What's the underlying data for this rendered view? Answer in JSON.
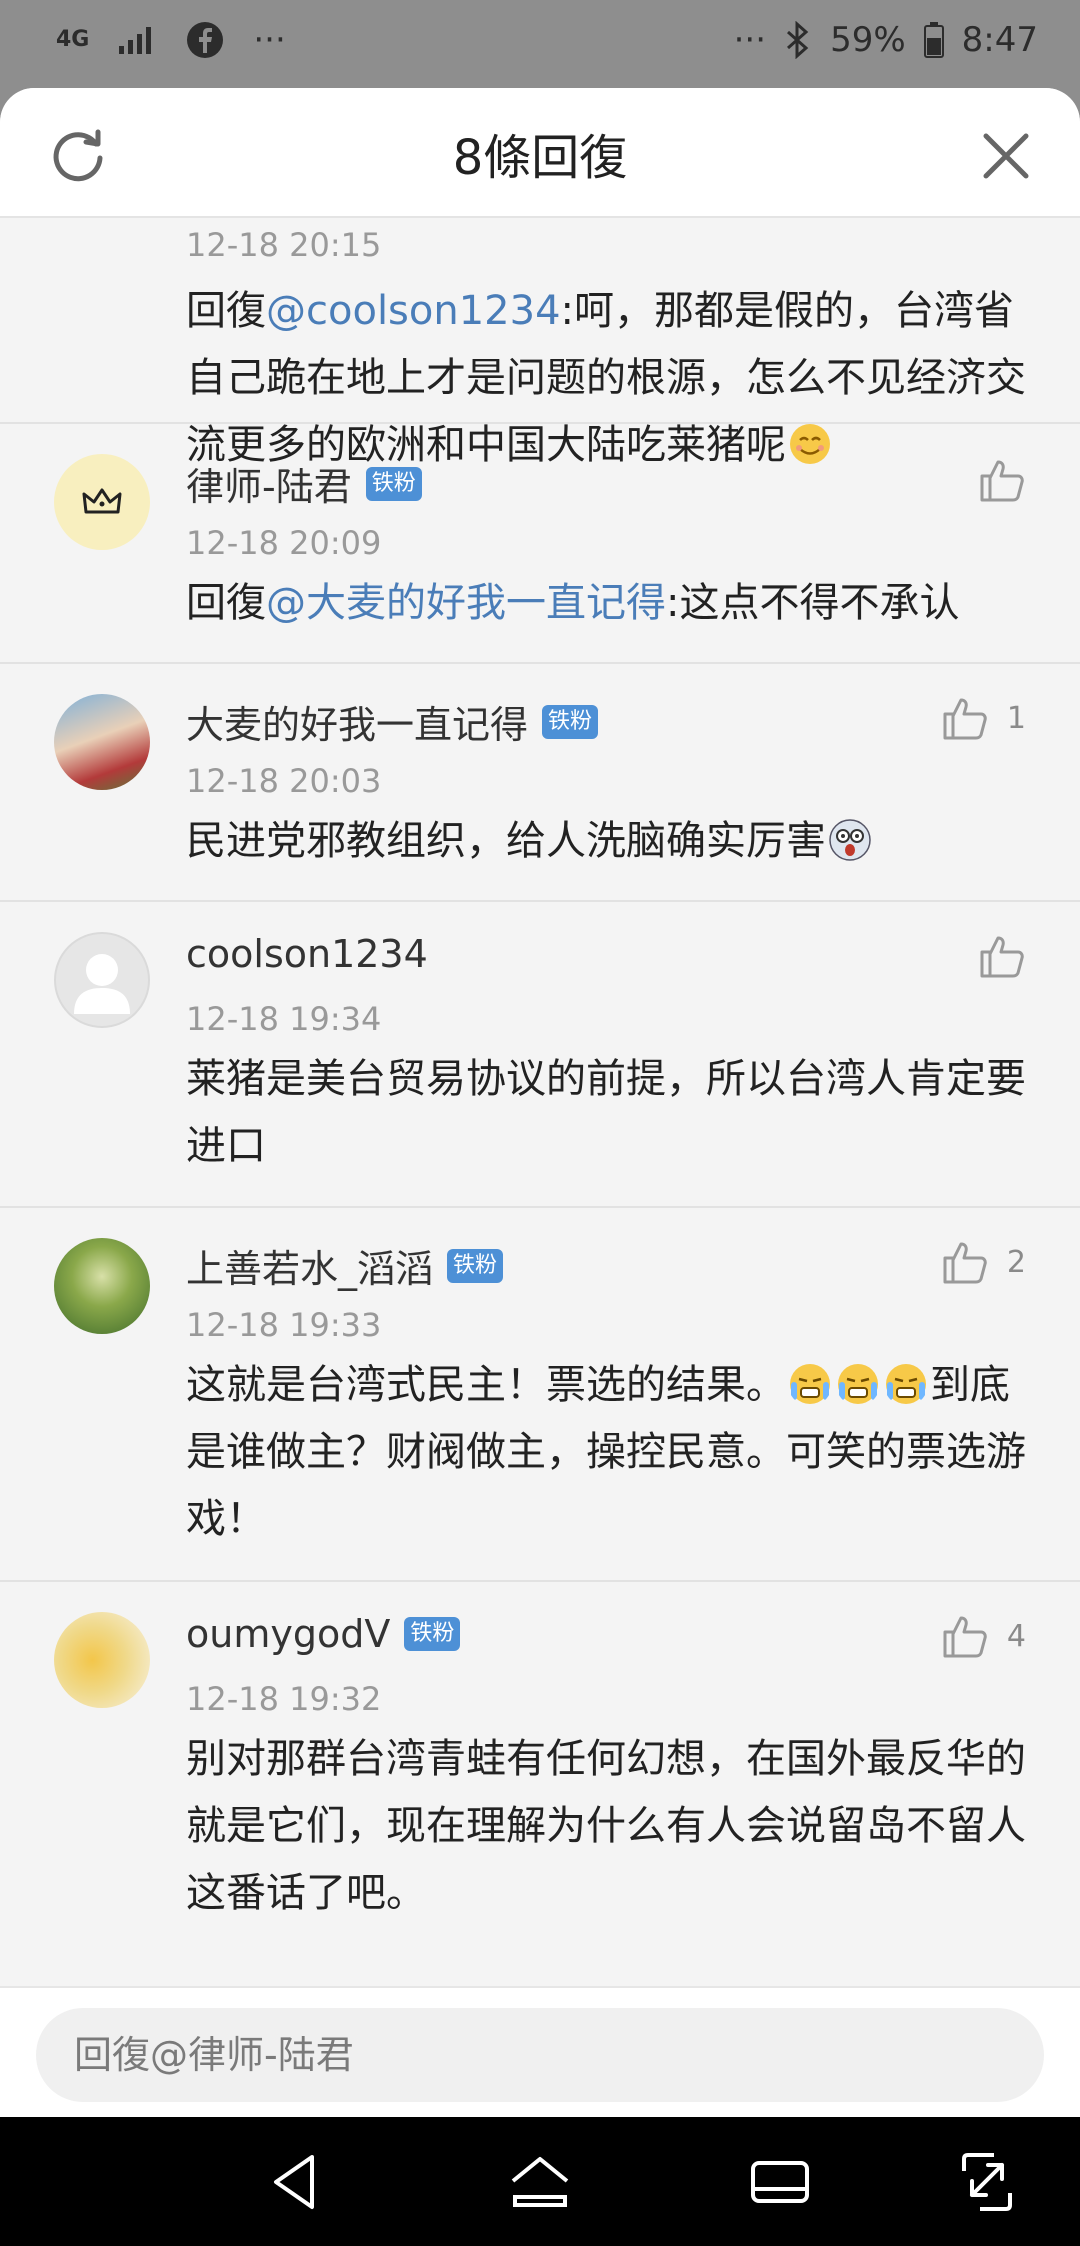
{
  "status_bar": {
    "network": "4G",
    "battery": "59%",
    "time": "8:47",
    "icons": [
      "signal-icon",
      "facebook-icon",
      "more-icon",
      "bluetooth-icon",
      "battery-icon"
    ]
  },
  "header": {
    "title": "8條回復",
    "icons": [
      "refresh-icon",
      "close-icon"
    ]
  },
  "comments": [
    {
      "time": "12-18 20:15",
      "reply_prefix": "回復",
      "mention": "@coolson1234",
      "text": ":呵，那都是假的，台湾省自己跪在地上才是问题的根源，怎么不见经济交流更多的欧洲和中国大陆吃莱猪呢",
      "emoji": "smile-emoji"
    },
    {
      "name": "律师-陆君",
      "badge": "铁粉",
      "time": "12-18 20:09",
      "reply_prefix": "回復",
      "mention": "@大麦的好我一直记得",
      "text": ":这点不得不承认",
      "likes": ""
    },
    {
      "name": "大麦的好我一直记得",
      "badge": "铁粉",
      "time": "12-18 20:03",
      "text": "民进党邪教组织，给人洗脑确实厉害",
      "likes": "1",
      "emoji": "dizzy-emoji"
    },
    {
      "name": "coolson1234",
      "time": "12-18 19:34",
      "text": "莱猪是美台贸易协议的前提，所以台湾人肯定要进口",
      "likes": ""
    },
    {
      "name": "上善若水_滔滔",
      "badge": "铁粉",
      "time": "12-18 19:33",
      "text_before": "这就是台湾式民主！票选的结果。",
      "text_after": "到底是谁做主？财阀做主，操控民意。可笑的票选游戏！",
      "likes": "2",
      "emoji": "crying-emoji"
    },
    {
      "name": "oumygodV",
      "badge": "铁粉",
      "time": "12-18 19:32",
      "text": "别对那群台湾青蛙有任何幻想，在国外最反华的就是它们，现在理解为什么有人会说留岛不留人这番话了吧。",
      "likes": "4"
    }
  ],
  "reply_bar": {
    "placeholder": "回復@律师-陆君"
  },
  "nav_bar": {
    "icons": [
      "back-icon",
      "home-icon",
      "recents-icon",
      "rotate-icon"
    ]
  },
  "colors": {
    "accent_link": "#4a7db8",
    "badge": "#4d90d6",
    "sheet_bg": "#f4f4f4",
    "dimmed_bg": "#8e8e8e"
  }
}
